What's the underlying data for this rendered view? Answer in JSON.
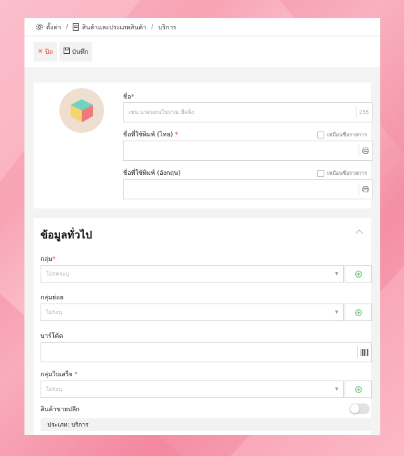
{
  "breadcrumb": {
    "settings": "ตั้งค่า",
    "products": "สินค้าและประเภทสินค้า",
    "current": "บริการ"
  },
  "toolbar": {
    "close_label": "ปิด",
    "save_label": "บันทึก"
  },
  "name_section": {
    "name_label": "ชื่อ",
    "name_placeholder": "เช่น นวดแผนโบราณ ฮีลลิ่ง",
    "name_counter": "255",
    "print_th_label": "ชื่อที่ใช้พิมพ์ (ไทย)",
    "print_en_label": "ชื่อที่ใช้พิมพ์ (อังกฤษ)",
    "same_as_name": "เหมือนชื่อรายการ"
  },
  "general": {
    "title": "ข้อมูลทั่วไป",
    "group_label": "กลุ่ม",
    "group_value": "โปรดระบุ",
    "subgroup_label": "กลุ่มย่อย",
    "subgroup_value": "ไม่ระบุ",
    "barcode_label": "บาร์โค้ด",
    "receipt_group_label": "กลุ่มใบเสร็จ",
    "receipt_group_value": "ไม่ระบุ",
    "retail_label": "สินค้าขายปลีก",
    "retail_enabled": false,
    "type_text": "ประเภท: บริการ"
  },
  "colors": {
    "accent_green": "#4caf50",
    "required_red": "#e53935",
    "close_red": "#e8493d"
  }
}
